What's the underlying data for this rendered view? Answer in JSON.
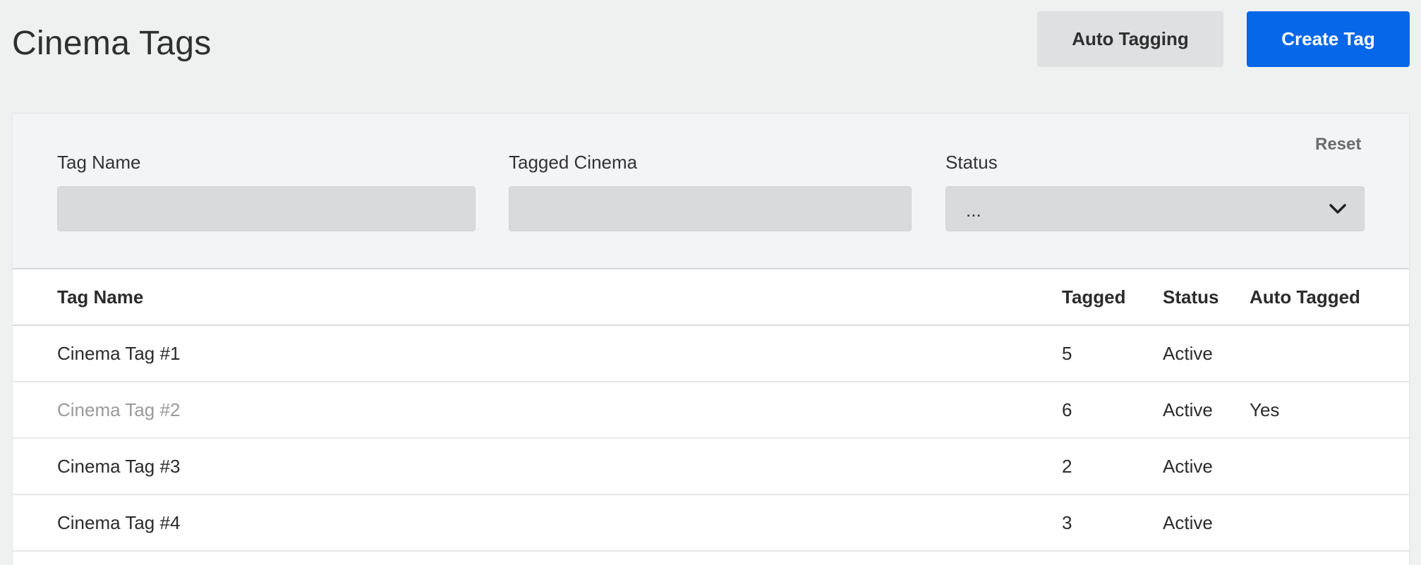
{
  "header": {
    "title": "Cinema Tags",
    "auto_tagging_label": "Auto Tagging",
    "create_tag_label": "Create Tag"
  },
  "filters": {
    "reset_label": "Reset",
    "tag_name": {
      "label": "Tag Name",
      "value": ""
    },
    "tagged_cinema": {
      "label": "Tagged Cinema",
      "value": ""
    },
    "status": {
      "label": "Status",
      "selected": "..."
    }
  },
  "table": {
    "columns": {
      "name": "Tag Name",
      "tagged": "Tagged",
      "status": "Status",
      "auto_tagged": "Auto Tagged"
    },
    "rows": [
      {
        "name": "Cinema Tag #1",
        "tagged": "5",
        "status": "Active",
        "auto_tagged": ""
      },
      {
        "name": "Cinema Tag #2",
        "tagged": "6",
        "status": "Active",
        "auto_tagged": "Yes"
      },
      {
        "name": "Cinema Tag #3",
        "tagged": "2",
        "status": "Active",
        "auto_tagged": ""
      },
      {
        "name": "Cinema Tag #4",
        "tagged": "3",
        "status": "Active",
        "auto_tagged": ""
      }
    ]
  },
  "colors": {
    "primary": "#0667e8",
    "background": "#eff0f0",
    "muted_text": "#9a9a9a"
  },
  "icons": {
    "status_select": "chevron-down-icon"
  }
}
